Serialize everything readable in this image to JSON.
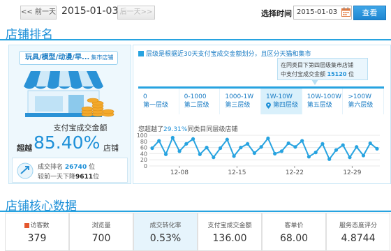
{
  "topbar": {
    "prev_day": "<< 前一天",
    "current_date": "2015-01-03",
    "next_day": "后一天>>",
    "select_time_label": "选择时间",
    "date_value": "2015-01-03",
    "query_button": "查看"
  },
  "ranking": {
    "section_title": "店铺排名",
    "category_tag": "玩具/模型/动漫/早...",
    "category_tag_sub": "集市店铺",
    "metric_label": "支付宝成交金额",
    "exceed_prefix": "超越",
    "exceed_percent": "85.40%",
    "exceed_suffix": "店铺",
    "txn_rank_label": "成交排名",
    "txn_rank_value": "26740",
    "txn_rank_unit": "位",
    "compare_label": "较前一天下降",
    "compare_value": "9611",
    "compare_unit": "位"
  },
  "tier_panel": {
    "legend": "层级是根据近30天支付宝成交金额划分，且区分天猫和集市",
    "info_line1": "在同类目下第四层级集市店铺",
    "info_line2_prefix": "中支付宝成交金额",
    "info_value": "15120",
    "info_unit": "位",
    "tiers": [
      {
        "range": "0",
        "name": "第一层级",
        "active": false
      },
      {
        "range": "0-1000",
        "name": "第二层级",
        "active": false
      },
      {
        "range": "1000-1W",
        "name": "第三层级",
        "active": false
      },
      {
        "range": "1W-10W",
        "name": "第四层级",
        "active": true
      },
      {
        "range": "10W-100W",
        "name": "第五层级",
        "active": false
      },
      {
        "range": ">100W",
        "name": "第六层级",
        "active": false
      }
    ],
    "perf_prefix": "您超越了",
    "perf_value": "29.31%",
    "perf_suffix": "同类目同层级店铺"
  },
  "chart_data": {
    "type": "line",
    "y_ticks": [
      "100",
      "80",
      "60",
      "40",
      "20",
      "0"
    ],
    "ylim": [
      0,
      100
    ],
    "x_ticks": [
      "12-08",
      "12-15",
      "12-22",
      "12-29"
    ],
    "values": [
      58,
      82,
      38,
      92,
      48,
      72,
      88,
      38,
      60,
      28,
      58,
      86,
      32,
      60,
      72,
      42,
      62,
      90,
      40,
      48,
      74,
      62,
      82,
      30,
      44,
      72,
      22,
      52,
      68,
      28,
      62,
      34,
      74,
      56
    ],
    "grid": true,
    "color": "#27a3e0"
  },
  "core": {
    "section_title": "店铺核心数据",
    "cards": [
      {
        "label": "访客数",
        "value": "379",
        "highlight": false,
        "icon": "flag-icon"
      },
      {
        "label": "浏览量",
        "value": "700",
        "highlight": false
      },
      {
        "label": "成交转化率",
        "value": "0.53%",
        "highlight": true
      },
      {
        "label": "支付宝成交金额",
        "value": "136.00",
        "highlight": false
      },
      {
        "label": "客单价",
        "value": "68.00",
        "highlight": false
      },
      {
        "label": "服务态度评分",
        "value": "4.8744",
        "highlight": false
      }
    ]
  }
}
